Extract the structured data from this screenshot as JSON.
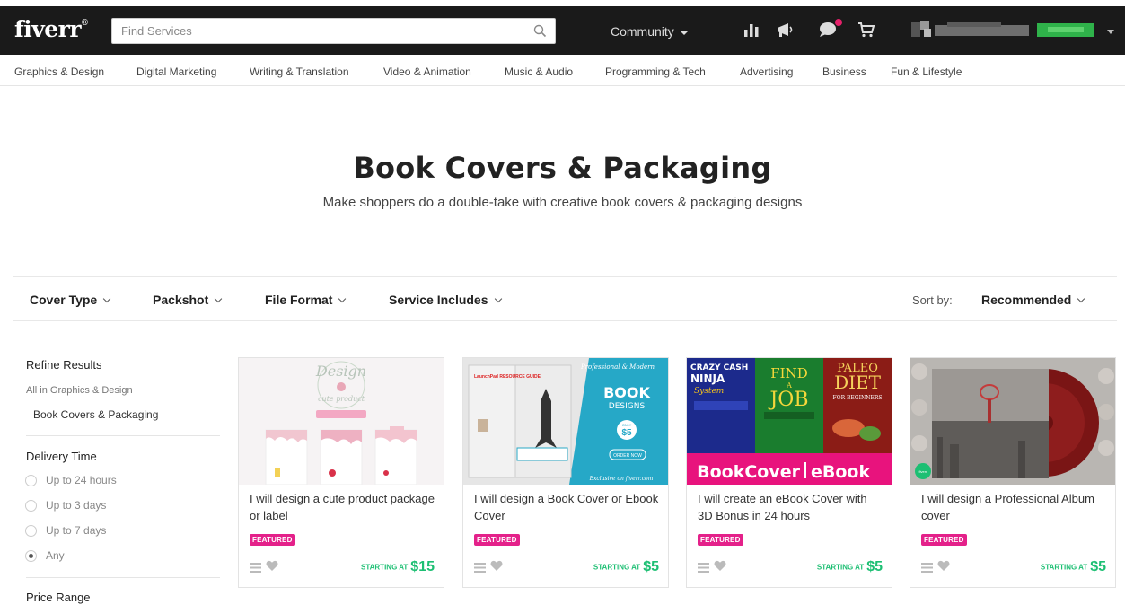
{
  "header": {
    "logo": "fiverr",
    "logo_mark": "®",
    "search_placeholder": "Find Services",
    "community_label": "Community"
  },
  "categories": [
    "Graphics & Design",
    "Digital Marketing",
    "Writing & Translation",
    "Video & Animation",
    "Music & Audio",
    "Programming & Tech",
    "Advertising",
    "Business",
    "Fun & Lifestyle"
  ],
  "hero": {
    "title": "Book Covers & Packaging",
    "subtitle": "Make shoppers do a double-take with creative book covers & packaging designs"
  },
  "filters": [
    "Cover Type",
    "Packshot",
    "File Format",
    "Service Includes"
  ],
  "sort": {
    "label": "Sort by:",
    "value": "Recommended"
  },
  "sidebar": {
    "refine_title": "Refine Results",
    "parent_link": "All in Graphics & Design",
    "current_category": "Book Covers & Packaging",
    "delivery_title": "Delivery Time",
    "delivery_options": [
      {
        "label": "Up to 24 hours",
        "selected": false
      },
      {
        "label": "Up to 3 days",
        "selected": false
      },
      {
        "label": "Up to 7 days",
        "selected": false
      },
      {
        "label": "Any",
        "selected": true
      }
    ],
    "next_section_title": "Price Range"
  },
  "gigs": [
    {
      "title": "I will design a cute product package or label",
      "badge": "FEATURED",
      "starting_label": "STARTING AT",
      "price": "$15",
      "image_text": [
        "Design",
        "cute product"
      ]
    },
    {
      "title": "I will design a Book Cover or Ebook Cover",
      "badge": "FEATURED",
      "starting_label": "STARTING AT",
      "price": "$5",
      "image_text": [
        "Professional & Modern",
        "BOOK",
        "DESIGNS",
        "ONLY",
        "$5",
        "ORDER NOW",
        "Exclusive on fiverr.com",
        "LaunchPad RESOURCE GUIDE"
      ]
    },
    {
      "title": "I will create an eBook Cover with 3D Bonus in 24 hours",
      "badge": "FEATURED",
      "starting_label": "STARTING AT",
      "price": "$5",
      "image_text": [
        "CRAZY CASH",
        "NINJA",
        "System",
        "FIND",
        "A",
        "JOB",
        "PALEO",
        "DIET",
        "FOR BEGINNERS",
        "BookCover",
        "eBook"
      ]
    },
    {
      "title": "I will design a Professional Album cover",
      "badge": "FEATURED",
      "starting_label": "STARTING AT",
      "price": "$5",
      "image_text": [
        "fiverr"
      ]
    }
  ],
  "colors": {
    "header_bg": "#1a1a1a",
    "brand_green": "#1dbf73",
    "featured_pink": "#e4218a"
  }
}
